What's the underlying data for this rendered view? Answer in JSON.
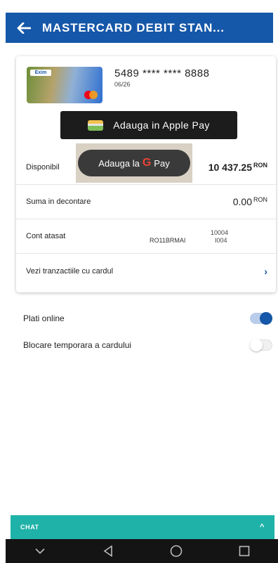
{
  "header": {
    "title": "MASTERCARD DEBIT STAN...",
    "back_icon": "arrow-left-icon"
  },
  "card": {
    "brand_label": "Exim",
    "number": "5489 **** **** 8888",
    "expiry": "06/26",
    "apple_pay_label": "Adauga in Apple Pay",
    "google_pay_label_prefix": "Adauga la",
    "google_pay_g": "G",
    "google_pay_label_suffix": "Pay"
  },
  "rows": {
    "available_label": "Disponibil",
    "available_value": "10 437.25",
    "available_currency": "RON",
    "settlement_label": "Suma in decontare",
    "settlement_value": "0.00",
    "settlement_currency": "RON",
    "account_label": "Cont atasat",
    "account_iban": "RO11BRMAI",
    "account_line1": "10004",
    "account_line2": "I004",
    "transactions_label": "Vezi tranzactiile cu cardul"
  },
  "settings": {
    "online_payments_label": "Plati online",
    "online_payments_enabled": true,
    "temp_block_label": "Blocare temporara a cardului",
    "temp_block_enabled": false
  },
  "chat": {
    "label": "CHAT"
  },
  "colors": {
    "primary": "#1557a8",
    "chat": "#1fb2a8",
    "navbar": "#141414"
  }
}
